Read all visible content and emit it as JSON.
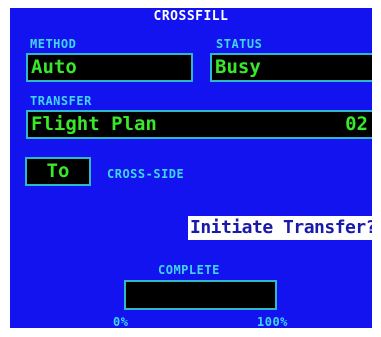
{
  "title": "CROSSFILL",
  "method": {
    "label": "METHOD",
    "value": "Auto"
  },
  "status": {
    "label": "STATUS",
    "value": "Busy"
  },
  "transfer": {
    "label": "TRANSFER",
    "value": "Flight Plan",
    "number": "02"
  },
  "direction": {
    "value": "To",
    "label": "CROSS-SIDE"
  },
  "action": {
    "label": "Initiate Transfer?"
  },
  "progress": {
    "label": "COMPLETE",
    "min_label": "0%",
    "max_label": "100%",
    "percent": 0
  },
  "colors": {
    "background": "#1313ef",
    "label": "#3fd6f2",
    "value": "#39e82a",
    "border": "#2fb8c8"
  }
}
